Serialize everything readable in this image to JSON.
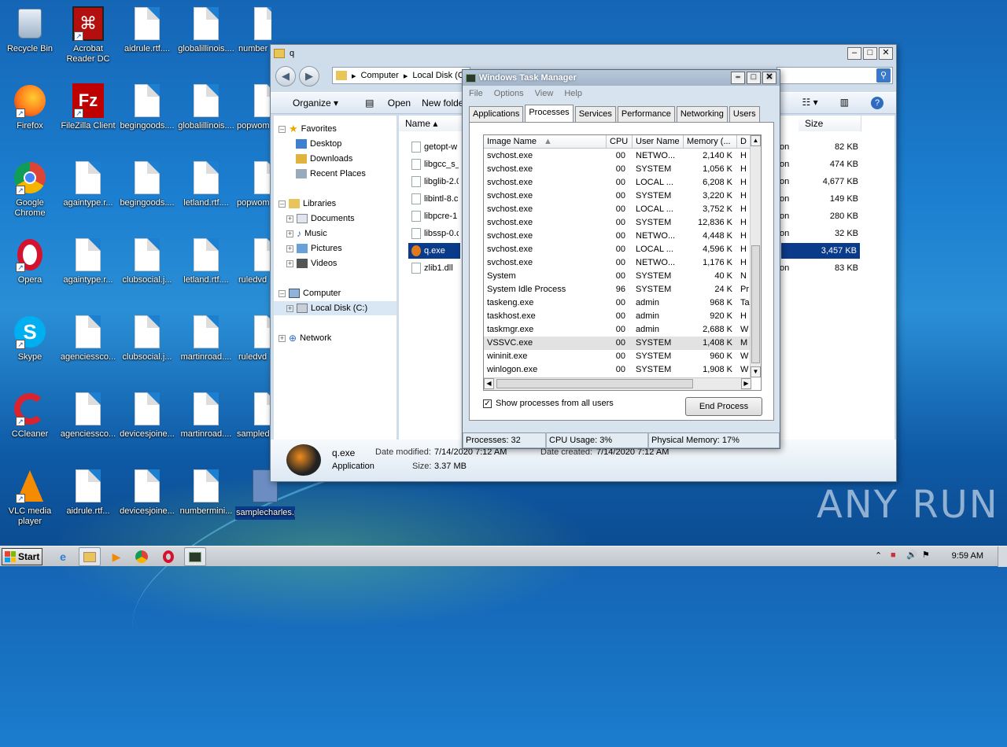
{
  "desktop": {
    "icons": [
      {
        "label": "Recycle Bin"
      },
      {
        "label": "Acrobat Reader DC"
      },
      {
        "label": "aidrule.rtf...."
      },
      {
        "label": "globalillinois...."
      },
      {
        "label": "number"
      },
      {
        "label": "Firefox"
      },
      {
        "label": "FileZilla Client"
      },
      {
        "label": "begingoods...."
      },
      {
        "label": "globalillinois...."
      },
      {
        "label": "popwom"
      },
      {
        "label": "Google Chrome"
      },
      {
        "label": "againtype.r..."
      },
      {
        "label": "begingoods...."
      },
      {
        "label": "letland.rtf...."
      },
      {
        "label": "popwom"
      },
      {
        "label": "Opera"
      },
      {
        "label": "againtype.r..."
      },
      {
        "label": "clubsocial.j..."
      },
      {
        "label": "letland.rtf...."
      },
      {
        "label": "ruledvd"
      },
      {
        "label": "Skype"
      },
      {
        "label": "agenciessco..."
      },
      {
        "label": "clubsocial.j..."
      },
      {
        "label": "martinroad...."
      },
      {
        "label": "ruledvd"
      },
      {
        "label": "CCleaner"
      },
      {
        "label": "agenciessco..."
      },
      {
        "label": "devicesjoine..."
      },
      {
        "label": "martinroad...."
      },
      {
        "label": "sampled"
      },
      {
        "label": "VLC media player"
      },
      {
        "label": "aidrule.rtf..."
      },
      {
        "label": "devicesjoine..."
      },
      {
        "label": "numbermini..."
      },
      {
        "label": "samplecharles.png.garminwasted_info"
      }
    ]
  },
  "explorer": {
    "title": "q",
    "breadcrumb": [
      "Computer",
      "Local Disk (C:)"
    ],
    "toolbar": {
      "organize": "Organize",
      "open": "Open",
      "new_folder": "New folder"
    },
    "nav": {
      "favorites": "Favorites",
      "desktop": "Desktop",
      "downloads": "Downloads",
      "recent": "Recent Places",
      "libraries": "Libraries",
      "documents": "Documents",
      "music": "Music",
      "pictures": "Pictures",
      "videos": "Videos",
      "computer": "Computer",
      "local_disk": "Local Disk (C:)",
      "network": "Network"
    },
    "columns": {
      "name": "Name",
      "size": "Size"
    },
    "files": [
      {
        "name": "getopt-w",
        "type_frag": "on",
        "size": "82 KB"
      },
      {
        "name": "libgcc_s_",
        "type_frag": "on",
        "size": "474 KB"
      },
      {
        "name": "libglib-2.0",
        "type_frag": "on",
        "size": "4,677 KB"
      },
      {
        "name": "libintl-8.c",
        "type_frag": "on",
        "size": "149 KB"
      },
      {
        "name": "libpcre-1",
        "type_frag": "on",
        "size": "280 KB"
      },
      {
        "name": "libssp-0.c",
        "type_frag": "on",
        "size": "32 KB"
      },
      {
        "name": "q.exe",
        "type_frag": "",
        "size": "3,457 KB"
      },
      {
        "name": "zlib1.dll",
        "type_frag": "on",
        "size": "83 KB"
      }
    ],
    "details": {
      "name": "q.exe",
      "type": "Application",
      "modified_label": "Date modified:",
      "modified": "7/14/2020 7:12 AM",
      "created_label": "Date created:",
      "created": "7/14/2020 7:12 AM",
      "size_label": "Size:",
      "size": "3.37 MB"
    }
  },
  "taskmgr": {
    "title": "Windows Task Manager",
    "menu": [
      "File",
      "Options",
      "View",
      "Help"
    ],
    "tabs": [
      "Applications",
      "Processes",
      "Services",
      "Performance",
      "Networking",
      "Users"
    ],
    "active_tab": "Processes",
    "columns": [
      "Image Name",
      "CPU",
      "User Name",
      "Memory (...",
      "D"
    ],
    "processes": [
      {
        "name": "svchost.exe",
        "cpu": "00",
        "user": "NETWO...",
        "mem": "2,140 K",
        "d": "H"
      },
      {
        "name": "svchost.exe",
        "cpu": "00",
        "user": "SYSTEM",
        "mem": "1,056 K",
        "d": "H"
      },
      {
        "name": "svchost.exe",
        "cpu": "00",
        "user": "LOCAL ...",
        "mem": "6,208 K",
        "d": "H"
      },
      {
        "name": "svchost.exe",
        "cpu": "00",
        "user": "SYSTEM",
        "mem": "3,220 K",
        "d": "H"
      },
      {
        "name": "svchost.exe",
        "cpu": "00",
        "user": "LOCAL ...",
        "mem": "3,752 K",
        "d": "H"
      },
      {
        "name": "svchost.exe",
        "cpu": "00",
        "user": "SYSTEM",
        "mem": "12,836 K",
        "d": "H"
      },
      {
        "name": "svchost.exe",
        "cpu": "00",
        "user": "NETWO...",
        "mem": "4,448 K",
        "d": "H"
      },
      {
        "name": "svchost.exe",
        "cpu": "00",
        "user": "LOCAL ...",
        "mem": "4,596 K",
        "d": "H"
      },
      {
        "name": "svchost.exe",
        "cpu": "00",
        "user": "NETWO...",
        "mem": "1,176 K",
        "d": "H"
      },
      {
        "name": "System",
        "cpu": "00",
        "user": "SYSTEM",
        "mem": "40 K",
        "d": "N"
      },
      {
        "name": "System Idle Process",
        "cpu": "96",
        "user": "SYSTEM",
        "mem": "24 K",
        "d": "Pr"
      },
      {
        "name": "taskeng.exe",
        "cpu": "00",
        "user": "admin",
        "mem": "968 K",
        "d": "Ta"
      },
      {
        "name": "taskhost.exe",
        "cpu": "00",
        "user": "admin",
        "mem": "920 K",
        "d": "H"
      },
      {
        "name": "taskmgr.exe",
        "cpu": "00",
        "user": "admin",
        "mem": "2,688 K",
        "d": "W"
      },
      {
        "name": "VSSVC.exe",
        "cpu": "00",
        "user": "SYSTEM",
        "mem": "1,408 K",
        "d": "M"
      },
      {
        "name": "wininit.exe",
        "cpu": "00",
        "user": "SYSTEM",
        "mem": "960 K",
        "d": "W"
      },
      {
        "name": "winlogon.exe",
        "cpu": "00",
        "user": "SYSTEM",
        "mem": "1,908 K",
        "d": "W"
      }
    ],
    "show_all_label": "Show processes from all users",
    "show_all_checked": true,
    "end_process": "End Process",
    "status": {
      "processes": "Processes: 32",
      "cpu": "CPU Usage: 3%",
      "memory": "Physical Memory: 17%"
    }
  },
  "taskbar": {
    "start": "Start",
    "clock": "9:59 AM"
  },
  "watermark": "ANY RUN"
}
